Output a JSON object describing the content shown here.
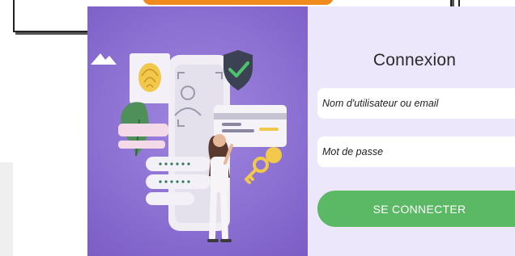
{
  "login": {
    "title": "Connexion",
    "username_placeholder": "Nom d'utilisateur ou email",
    "username_value": "",
    "password_placeholder": "Mot de passe",
    "password_value": "",
    "submit_label": "SE CONNECTER"
  },
  "colors": {
    "accent_orange": "#f08a1c",
    "illustration_bg": "#8c70d2",
    "panel_bg": "#ede7fb",
    "button_green": "#5bb865"
  },
  "icons": [
    "shield-check-icon",
    "fingerprint-icon",
    "face-id-icon",
    "credit-card-icon",
    "key-icon",
    "mountain-icon"
  ]
}
